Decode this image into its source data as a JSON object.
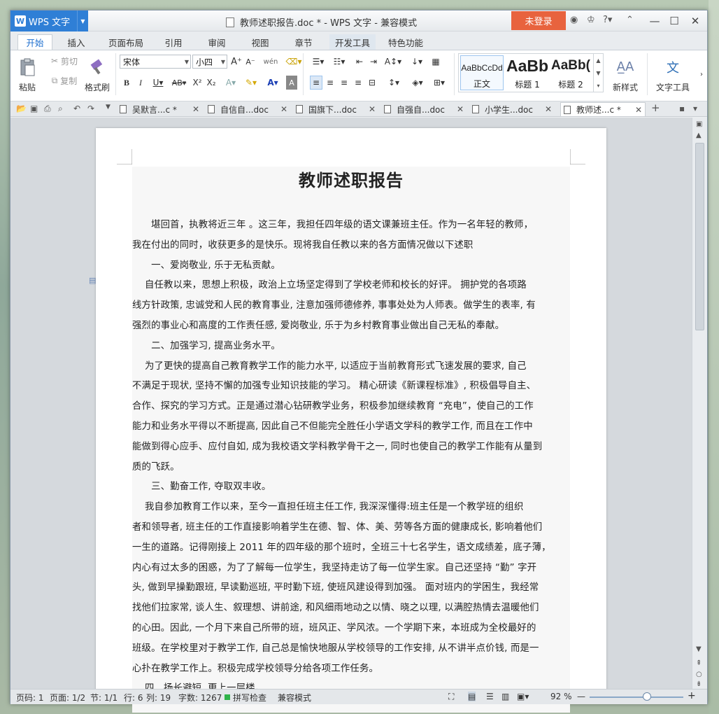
{
  "app": {
    "name": "WPS 文字",
    "title": "教师述职报告.doc * - WPS 文字 - 兼容模式",
    "login": "未登录"
  },
  "menu_tabs": [
    "开始",
    "插入",
    "页面布局",
    "引用",
    "审阅",
    "视图",
    "章节",
    "开发工具",
    "特色功能"
  ],
  "ribbon": {
    "paste": "粘贴",
    "cut": "剪切",
    "copy": "复制",
    "format_painter": "格式刷",
    "font_name": "宋体",
    "font_size": "小四",
    "styles": [
      {
        "sample": "AaBbCcDd",
        "name": "正文"
      },
      {
        "sample": "AaBb",
        "name": "标题 1"
      },
      {
        "sample": "AaBb(",
        "name": "标题 2"
      }
    ],
    "new_style": "新样式",
    "text_tools": "文字工具"
  },
  "doc_tabs": [
    "吴默言...c *",
    "自信自...doc",
    "国旗下...doc",
    "自强自...doc",
    "小学生...doc",
    "教师述...c *"
  ],
  "document": {
    "title": "教师述职报告",
    "lines": [
      "　　堪回首，执教将近三年 。这三年，我担任四年级的语文课兼班主任。作为一名年轻的教师，",
      "我在付出的同时，收获更多的是快乐。现将我自任教以来的各方面情况做以下述职",
      "　　一、爱岗敬业, 乐于无私贡献。",
      "　 自任教以来，思想上积极，政治上立场坚定得到了学校老师和校长的好评。  拥护党的各项路",
      "线方针政策, 忠诚党和人民的教育事业, 注意加强师德修养, 事事处处为人师表。做学生的表率, 有",
      "强烈的事业心和高度的工作责任感, 爱岗敬业, 乐于为乡村教育事业做出自己无私的奉献。",
      "　　二、加强学习, 提高业务水平。",
      "　 为了更快的提高自己教育教学工作的能力水平, 以适应于当前教育形式飞速发展的要求, 自己",
      "不满足于现状, 坚持不懈的加强专业知识技能的学习。 精心研读《新课程标准》, 积极倡导自主、",
      "合作、探究的学习方式。正是通过潜心钻研教学业务，积极参加继续教育 “充电”，使自己的工作",
      "能力和业务水平得以不断提高, 因此自己不但能完全胜任小学语文学科的教学工作, 而且在工作中",
      "能做到得心应手、应付自如, 成为我校语文学科教学骨干之一, 同时也使自己的教学工作能有从量到",
      "质的飞跃。",
      "　　三、勤奋工作, 夺取双丰收。",
      "　 我自参加教育工作以来，至今一直担任班主任工作, 我深深懂得:班主任是一个教学班的组织",
      "者和领导者, 班主任的工作直接影响着学生在德、智、体、美、劳等各方面的健康成长, 影响着他们",
      "一生的道路。记得刚接上 2011 年的四年级的那个班时，全班三十七名学生，语文成绩差，底子薄，",
      "内心有过太多的困惑，为了了解每一位学生，我坚持走访了每一位学生家。自己还坚持 “勤” 字开",
      "头, 做到早操勤跟班, 早读勤巡班, 平时勤下班, 使班风建设得到加强。  面对班内的学困生，我经常",
      "找他们拉家常, 谈人生、叙理想、讲前途, 和风细雨地动之以情、晓之以理, 以满腔热情去温暖他们",
      "的心田。因此, 一个月下来自己所带的班，班风正、学风浓。一个学期下来，本班成为全校最好的",
      "班级。在学校里对于教学工作, 自己总是愉快地服从学校领导的工作安排, 从不讲半点价钱, 而是一",
      "心扑在教学工作上。积极完成学校领导分给各项工作任务。",
      "　 四、扬长避短, 更上一层楼。"
    ]
  },
  "status": {
    "page_num": "页码: 1",
    "pages": "页面: 1/2",
    "section": "节: 1/1",
    "row": "行: 6",
    "col": "列: 19",
    "words": "字数: 1267",
    "spell": "拼写检查",
    "mode": "兼容模式",
    "zoom": "92 %"
  },
  "colors": {
    "accent": "#2f7fd6",
    "login": "#e8633e"
  }
}
